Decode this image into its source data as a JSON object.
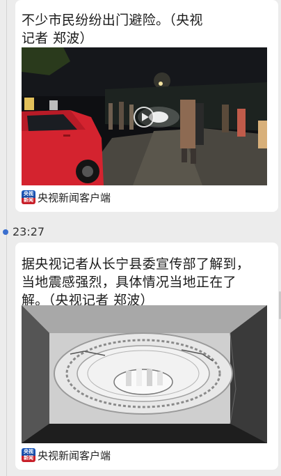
{
  "feed": {
    "post1": {
      "text_line1": "不少市民纷纷出门避险。（央视",
      "text_line2": "记者 郑波）",
      "source_label": "央视新闻客户端",
      "logo_text_top": "央视",
      "logo_text_bottom": "新闻"
    },
    "post2": {
      "time": "23:27",
      "text_line1": "据央视记者从长宁县委宣传部了解到，",
      "text_line2": "当地震感强烈，具体情况当地正在了",
      "text_line3": "解。（央视记者 郑波）",
      "source_label": "央视新闻客户端",
      "logo_text_top": "央视",
      "logo_text_bottom": "新闻"
    }
  },
  "colors": {
    "accent_dot": "#3b6fcf",
    "car_red": "#d4232f",
    "card_bg": "#ffffff",
    "page_bg": "#ececec"
  },
  "icons": [
    "play-icon",
    "cctv-news-logo-icon"
  ]
}
